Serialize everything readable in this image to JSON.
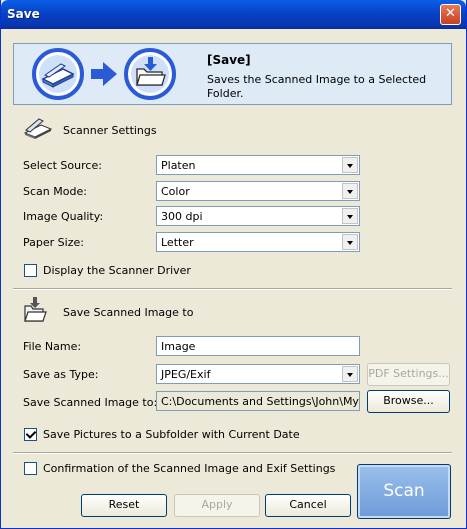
{
  "window": {
    "title": "Save"
  },
  "header": {
    "title": "[Save]",
    "description": "Saves the Scanned Image to a Selected Folder."
  },
  "scanner_settings": {
    "heading": "Scanner Settings",
    "select_source": {
      "label": "Select Source:",
      "value": "Platen"
    },
    "scan_mode": {
      "label": "Scan Mode:",
      "value": "Color"
    },
    "image_quality": {
      "label": "Image Quality:",
      "value": "300 dpi"
    },
    "paper_size": {
      "label": "Paper Size:",
      "value": "Letter"
    },
    "display_driver": {
      "label": "Display the Scanner Driver",
      "checked": false
    }
  },
  "save_settings": {
    "heading": "Save Scanned Image to",
    "file_name": {
      "label": "File Name:",
      "value": "Image"
    },
    "save_as_type": {
      "label": "Save as Type:",
      "value": "JPEG/Exif"
    },
    "pdf_settings_label": "PDF Settings...",
    "save_to": {
      "label": "Save Scanned Image to:",
      "value": "C:\\Documents and Settings\\John\\My Doc"
    },
    "browse_label": "Browse...",
    "subfolder": {
      "label": "Save Pictures to a Subfolder with Current Date",
      "checked": true
    }
  },
  "confirmation": {
    "label": "Confirmation of the Scanned Image and Exif Settings",
    "checked": false
  },
  "buttons": {
    "reset": "Reset",
    "apply": "Apply",
    "cancel": "Cancel",
    "scan": "Scan"
  },
  "colors": {
    "accent": "#0842c6",
    "header_bg": "#dfeaf7",
    "dialog_bg": "#ece9d8",
    "scan_button": "#7ea6de"
  }
}
